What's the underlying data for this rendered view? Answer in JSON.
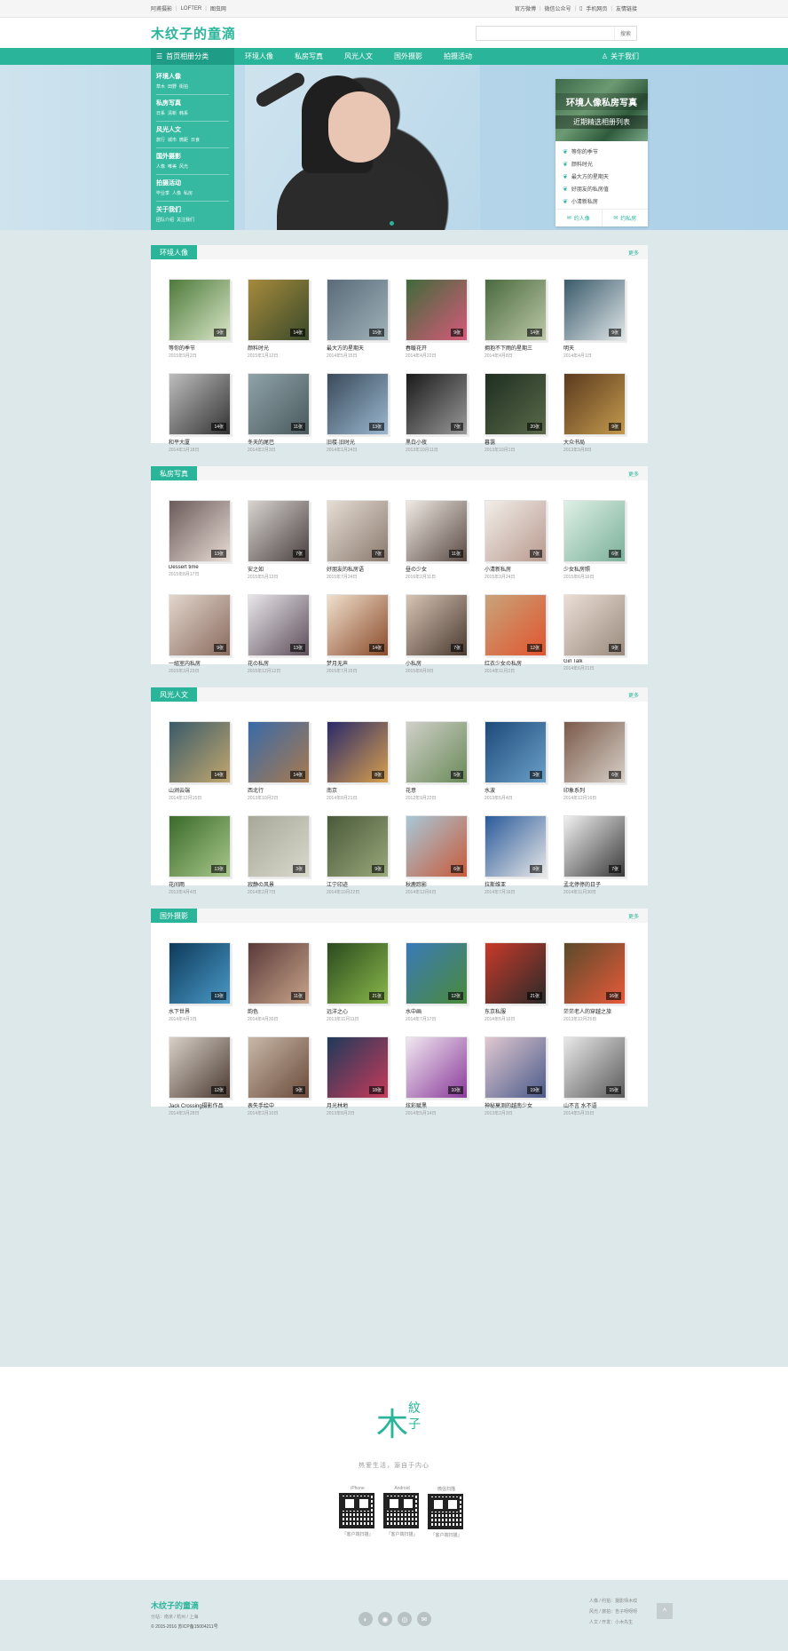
{
  "topbar": {
    "left": [
      "阿甫摄影",
      "LOFTER",
      "图虫网"
    ],
    "right": [
      "官方微博",
      "微信公众号",
      "手机网页",
      "友情链接"
    ]
  },
  "header": {
    "logo": "木纹子的童滴",
    "search_placeholder": "",
    "search_button": "搜索"
  },
  "nav": {
    "category": "首页相册分类",
    "items": [
      "环境人像",
      "私房写真",
      "风光人文",
      "国外摄影",
      "拍摄活动"
    ],
    "about": "关于我们"
  },
  "side_menu": [
    {
      "title": "环境人像",
      "sub": [
        "草木",
        "田野",
        "街拍"
      ]
    },
    {
      "title": "私房写真",
      "sub": [
        "日系",
        "清新",
        "韩系"
      ]
    },
    {
      "title": "风光人文",
      "sub": [
        "旅行",
        "城市",
        "微距",
        "日食"
      ]
    },
    {
      "title": "国外摄影",
      "sub": [
        "人像",
        "唯美",
        "风光"
      ]
    },
    {
      "title": "拍摄活动",
      "sub": [
        "毕业季",
        "人像",
        "私房"
      ]
    },
    {
      "title": "关于我们",
      "sub": [
        "团队介绍",
        "关注我们"
      ]
    }
  ],
  "promo": {
    "line1": "环境人像私房写真",
    "line2": "近期精选相册列表",
    "list": [
      "等你的季节",
      "颜料时光",
      "最大方的星期天",
      "好朋友的私房值",
      "小清新私房"
    ],
    "btn1": "约人像",
    "btn2": "约私房"
  },
  "sections": [
    {
      "title": "环境人像",
      "more": "更多",
      "cards": [
        {
          "title": "等你的季节",
          "date": "2015年9月2日",
          "count": "9张",
          "c1": "#4e7a3a",
          "c2": "#d9e6c8"
        },
        {
          "title": "颜料时光",
          "date": "2015年1月12日",
          "count": "14张",
          "c1": "#a68a3c",
          "c2": "#3a4a2a"
        },
        {
          "title": "最大方的星期天",
          "date": "2014年5月15日",
          "count": "15张",
          "c1": "#5a6a7a",
          "c2": "#9fb3b8"
        },
        {
          "title": "春暖花开",
          "date": "2014年4月22日",
          "count": "9张",
          "c1": "#3f6a3a",
          "c2": "#d85a7a"
        },
        {
          "title": "拥抱不下雨的星期三",
          "date": "2014年4月8日",
          "count": "14张",
          "c1": "#4a6a3e",
          "c2": "#bcc8a8"
        },
        {
          "title": "明天",
          "date": "2014年4月1日",
          "count": "9张",
          "c1": "#3a5a6a",
          "c2": "#dfe6e8"
        },
        {
          "title": "和平大厦",
          "date": "2014年3月18日",
          "count": "14张",
          "c1": "#bdbdbd",
          "c2": "#333333"
        },
        {
          "title": "冬天的尾巴",
          "date": "2014年2月3日",
          "count": "11张",
          "c1": "#8fa3a8",
          "c2": "#4a5a5e"
        },
        {
          "title": "旧楼·旧时光",
          "date": "2014年1月24日",
          "count": "13张",
          "c1": "#3a4a5a",
          "c2": "#9ab8d0"
        },
        {
          "title": "黑白小夜",
          "date": "2013年10月11日",
          "count": "7张",
          "c1": "#1a1a1a",
          "c2": "#999999"
        },
        {
          "title": "暮霭",
          "date": "2013年10月1日",
          "count": "20张",
          "c1": "#1e2e22",
          "c2": "#5a6a48"
        },
        {
          "title": "大众书局",
          "date": "2013年9月8日",
          "count": "9张",
          "c1": "#5a3a1e",
          "c2": "#c49a4e"
        }
      ]
    },
    {
      "title": "私房写真",
      "more": "更多",
      "cards": [
        {
          "title": "Dessert time",
          "date": "2015年8月17日",
          "count": "13张",
          "c1": "#6a5a5a",
          "c2": "#e8dcd4"
        },
        {
          "title": "安之如",
          "date": "2015年5月13日",
          "count": "7张",
          "c1": "#d8d4d0",
          "c2": "#4a4040"
        },
        {
          "title": "好朋友的私房语",
          "date": "2015年7月24日",
          "count": "7张",
          "c1": "#e6ddd4",
          "c2": "#8a7a6e"
        },
        {
          "title": "昼の少女",
          "date": "2016年2月11日",
          "count": "11张",
          "c1": "#f0eae4",
          "c2": "#5a4a44"
        },
        {
          "title": "小清新私房",
          "date": "2015年3月24日",
          "count": "7张",
          "c1": "#f2eeea",
          "c2": "#b89a8e"
        },
        {
          "title": "少女私房照",
          "date": "2015年6月16日",
          "count": "6张",
          "c1": "#dff0e6",
          "c2": "#7ab09a"
        },
        {
          "title": "一組室内私房",
          "date": "2015年3月23日",
          "count": "9张",
          "c1": "#e2d6cc",
          "c2": "#8a6a5e"
        },
        {
          "title": "花の私房",
          "date": "2015年12月12日",
          "count": "13张",
          "c1": "#e8e6ea",
          "c2": "#5e4e5a"
        },
        {
          "title": "梦月无声",
          "date": "2015年7月15日",
          "count": "14张",
          "c1": "#f0e0cc",
          "c2": "#8a4a2a"
        },
        {
          "title": "小私房",
          "date": "2015年8月9日",
          "count": "7张",
          "c1": "#d6c4b4",
          "c2": "#4a3a30"
        },
        {
          "title": "红衣少女の私房",
          "date": "2014年11月2日",
          "count": "12张",
          "c1": "#c8a47a",
          "c2": "#e0542e"
        },
        {
          "title": "Girl Talk",
          "date": "2014年6月21日",
          "count": "9张",
          "c1": "#eaded4",
          "c2": "#9a8a7e"
        }
      ]
    },
    {
      "title": "风光人文",
      "more": "更多",
      "cards": [
        {
          "title": "山涧云端",
          "date": "2014年12月15日",
          "count": "14张",
          "c1": "#3a5a6a",
          "c2": "#c2a86e"
        },
        {
          "title": "西北行",
          "date": "2013年10月2日",
          "count": "14张",
          "c1": "#3a6aa8",
          "c2": "#a87a4e"
        },
        {
          "title": "南京",
          "date": "2014年8月21日",
          "count": "8张",
          "c1": "#2a2a6a",
          "c2": "#d8a04e"
        },
        {
          "title": "花意",
          "date": "2012年9月22日",
          "count": "5张",
          "c1": "#d0d0c8",
          "c2": "#6a8a5a"
        },
        {
          "title": "水波",
          "date": "2013年5月4日",
          "count": "3张",
          "c1": "#1e4a7a",
          "c2": "#6aa0c8"
        },
        {
          "title": "印象系列",
          "date": "2014年12月16日",
          "count": "6张",
          "c1": "#7a5a4a",
          "c2": "#d8d0c8"
        },
        {
          "title": "花间雨",
          "date": "2013年4月4日",
          "count": "13张",
          "c1": "#3a6a2a",
          "c2": "#a8c88a"
        },
        {
          "title": "寂静の风景",
          "date": "2014年2月7日",
          "count": "3张",
          "c1": "#a8a89a",
          "c2": "#d8d8cc"
        },
        {
          "title": "江宁印迹",
          "date": "2014年10月22日",
          "count": "9张",
          "c1": "#4a5a3a",
          "c2": "#9aa87a"
        },
        {
          "title": "秋鹿踪影",
          "date": "2014年12月6日",
          "count": "6张",
          "c1": "#a8c8d8",
          "c2": "#c85a3a"
        },
        {
          "title": "拉斯维亚",
          "date": "2014年7月16日",
          "count": "8张",
          "c1": "#2a5a9a",
          "c2": "#e8e8e8"
        },
        {
          "title": "孟北停停的日子",
          "date": "2014年11月30日",
          "count": "7张",
          "c1": "#f0f0f0",
          "c2": "#3a3a3a"
        }
      ]
    },
    {
      "title": "国外摄影",
      "more": "更多",
      "cards": [
        {
          "title": "水下世界",
          "date": "2014年4月1日",
          "count": "13张",
          "c1": "#0e3a5a",
          "c2": "#4a9ac8"
        },
        {
          "title": "韵色",
          "date": "2014年4月30日",
          "count": "11张",
          "c1": "#5a3a3a",
          "c2": "#c8a48a"
        },
        {
          "title": "远洋之心",
          "date": "2013年11月11日",
          "count": "21张",
          "c1": "#2a4a1e",
          "c2": "#8ab84a"
        },
        {
          "title": "水中画",
          "date": "2014年7月17日",
          "count": "12张",
          "c1": "#3a7ab8",
          "c2": "#4a8a3a"
        },
        {
          "title": "东京私服",
          "date": "2014年5月16日",
          "count": "21张",
          "c1": "#c83a2a",
          "c2": "#2a2a2a"
        },
        {
          "title": "茫茫老人的穿越之旅",
          "date": "2013年12月25日",
          "count": "16张",
          "c1": "#5a4a2a",
          "c2": "#e85a3a"
        },
        {
          "title": "Jack Crossing摄影作品",
          "date": "2014年3月28日",
          "count": "12张",
          "c1": "#d8d0c8",
          "c2": "#4a3a30"
        },
        {
          "title": "表失手绘中",
          "date": "2014年2月10日",
          "count": "9张",
          "c1": "#c8b8a8",
          "c2": "#6a4a3a"
        },
        {
          "title": "月光林地",
          "date": "2013年8月2日",
          "count": "18张",
          "c1": "#1e3a5a",
          "c2": "#c83a5a"
        },
        {
          "title": "炫彩赋黑",
          "date": "2014年5月14日",
          "count": "10张",
          "c1": "#f0e8f0",
          "c2": "#8a3a9a"
        },
        {
          "title": "神秘莫测的越南少女",
          "date": "2013年2月3日",
          "count": "19张",
          "c1": "#e0c8d0",
          "c2": "#4a5a8a"
        },
        {
          "title": "山不言 水不语",
          "date": "2014年5月15日",
          "count": "15张",
          "c1": "#e8e8e8",
          "c2": "#5a5a5a"
        }
      ]
    }
  ],
  "footer": {
    "logo_big": "木",
    "logo_sm1": "紋",
    "logo_sm2": "子",
    "slogan": "热爱生活，源自于内心",
    "qr": [
      {
        "label": "iPhone",
        "caption": "「客户端扫描」"
      },
      {
        "label": "Android",
        "caption": "「客户端扫描」"
      },
      {
        "label": "微信扫描",
        "caption": "「客户端扫描」"
      }
    ],
    "bottom_logo": "木纹子的童滴",
    "bottom_a": "分站：南京 / 杭州 / 上海",
    "bottom_b": "© 2015-2016 苏ICP备15004211号",
    "right_lines": [
      "人像 / 约拍：摄影师木纹",
      "风光 / 旅拍：告子呀呀呀",
      "人文 / 开发：小木先生"
    ],
    "back_top": "^"
  },
  "colors": {
    "accent": "#2ab59a",
    "accent_dark": "#1e9c85",
    "page_bg": "#dde8ea"
  }
}
